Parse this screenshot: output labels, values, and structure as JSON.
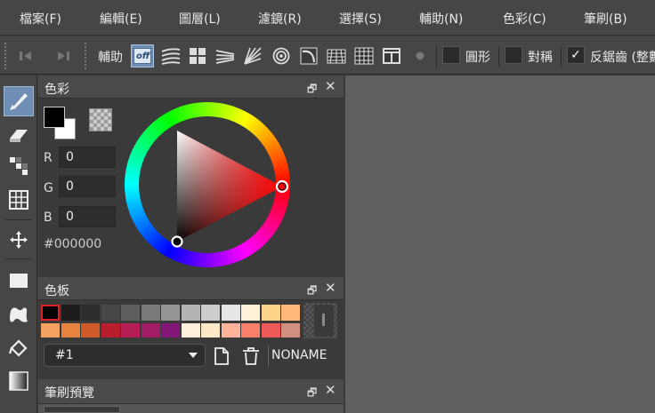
{
  "menu": {
    "items": [
      "檔案(F)",
      "編輯(E)",
      "圖層(L)",
      "濾鏡(R)",
      "選擇(S)",
      "輔助(N)",
      "色彩(C)",
      "筆刷(B)"
    ]
  },
  "toolbar": {
    "assist_label": "輔助",
    "off_label": "off",
    "circle_label": "圓形",
    "symmetry_label": "對稱",
    "antialias_label": "反鋸齒 (整數",
    "antialias_checked_mark": "✓"
  },
  "color_panel": {
    "title": "色彩",
    "r_label": "R",
    "g_label": "G",
    "b_label": "B",
    "r_value": "0",
    "g_value": "0",
    "b_value": "0",
    "hex": "#000000",
    "foreground": "#000000",
    "background": "#ffffff"
  },
  "palette_panel": {
    "title": "色板",
    "swatches_row1": [
      "#000000",
      "#1c1c1c",
      "#2e2e2e",
      "#474747",
      "#5e5e5e",
      "#7a7a7a",
      "#969696",
      "#b4b4b4",
      "#cdcdcd",
      "#e6e6e6",
      "#fff2d9",
      "#fdd38a",
      "#fdb87a"
    ],
    "swatches_row2": [
      "#f4a262",
      "#e88240",
      "#d05a28",
      "#b81e2c",
      "#b51e55",
      "#a21c66",
      "#831777",
      "#fff0dc",
      "#ffe8c8",
      "#ffb39a",
      "#f8806a",
      "#f05a5a",
      "#d09080"
    ],
    "selected": "#1",
    "name": "NONAME"
  },
  "brush_preview_panel": {
    "title": "筆刷預覽"
  },
  "colors": {
    "menubar_bg": "#464646",
    "panel_bg": "#3a3a3a",
    "canvas_bg": "#606060",
    "active_tool": "#6e8fb3"
  }
}
